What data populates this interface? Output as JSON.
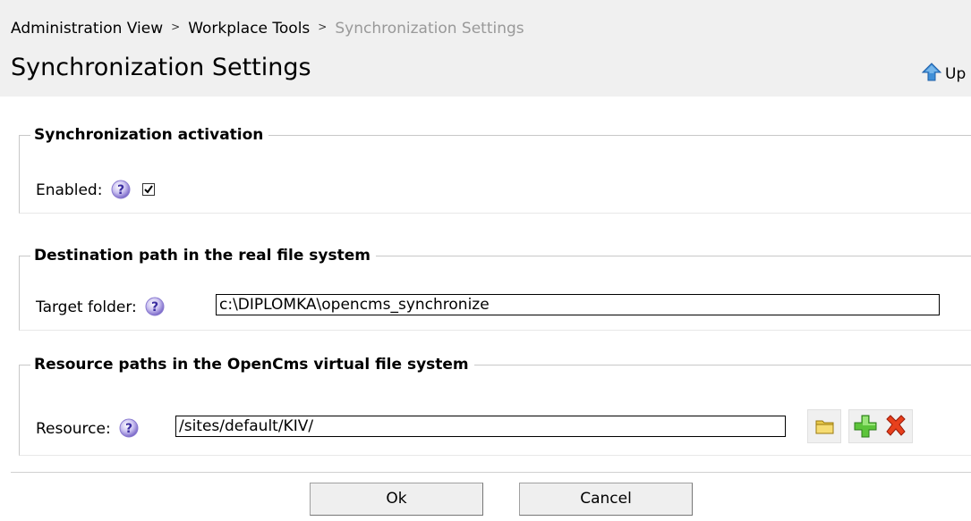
{
  "breadcrumb": {
    "items": [
      "Administration View",
      "Workplace Tools",
      "Synchronization Settings"
    ],
    "separator": ">"
  },
  "page": {
    "title": "Synchronization Settings",
    "up_label": "Up"
  },
  "activation": {
    "legend": "Synchronization activation",
    "enabled_label": "Enabled:",
    "enabled_checked": true
  },
  "destination": {
    "legend": "Destination path in the real file system",
    "target_label": "Target folder:",
    "target_value": "c:\\DIPLOMKA\\opencms_synchronize"
  },
  "resources": {
    "legend": "Resource paths in the OpenCms virtual file system",
    "resource_label": "Resource:",
    "resource_value": "/sites/default/KIV/"
  },
  "actions": {
    "ok_label": "Ok",
    "cancel_label": "Cancel"
  },
  "colors": {
    "header_bg": "#f0f0f0",
    "help_icon": "#8a7ad0",
    "breadcrumb_current": "#999999"
  }
}
